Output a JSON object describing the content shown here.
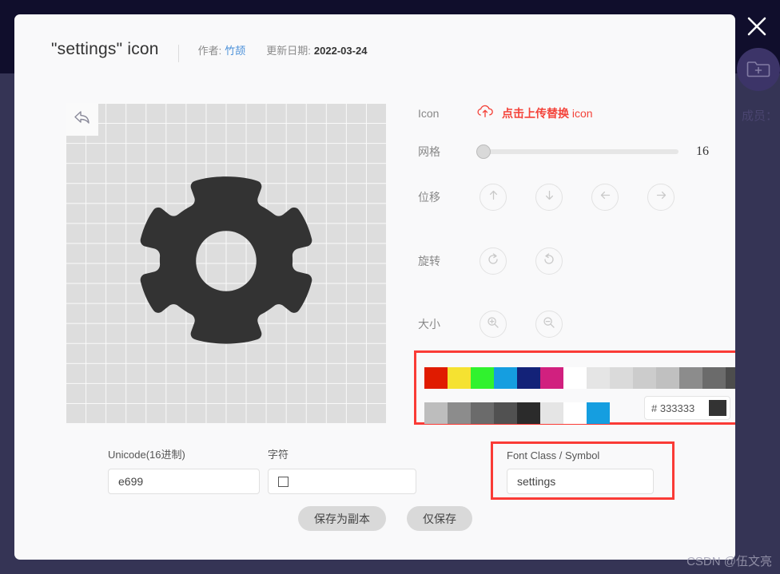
{
  "backdrop": {
    "close_icon": "close-icon",
    "folder_add_icon": "folder-plus-icon",
    "member_label": "成员：",
    "colors": {
      "top": "#100e2c",
      "body": "#353455",
      "circle": "#3c3468"
    }
  },
  "header": {
    "title_quoted": "\"settings\"",
    "title_suffix": "icon",
    "author_label": "作者:",
    "author_name": "竹颉",
    "date_label": "更新日期:",
    "date_value": "2022-03-24"
  },
  "canvas": {
    "undo_icon": "undo-arrow-icon",
    "glyph_icon": "gear-icon",
    "glyph_color": "#333333",
    "grid_cells": 16
  },
  "controls": {
    "icon_row": {
      "label": "Icon",
      "upload_icon": "cloud-upload-icon",
      "upload_text_cn": "点击上传替换 ",
      "upload_text_en": "icon",
      "accent": "#f4433a"
    },
    "grid_row": {
      "label": "网格",
      "value": "16",
      "min": 0,
      "max": 100,
      "thumb_percent": 0
    },
    "move_row": {
      "label": "位移",
      "buttons": [
        {
          "name": "move-up-button",
          "icon": "arrow-up-icon"
        },
        {
          "name": "move-down-button",
          "icon": "arrow-down-icon"
        },
        {
          "name": "move-left-button",
          "icon": "arrow-left-icon"
        },
        {
          "name": "move-right-button",
          "icon": "arrow-right-icon"
        }
      ]
    },
    "rotate_row": {
      "label": "旋转",
      "buttons": [
        {
          "name": "rotate-cw-button",
          "icon": "rotate-clockwise-icon"
        },
        {
          "name": "rotate-ccw-button",
          "icon": "rotate-counterclockwise-icon"
        }
      ]
    },
    "size_row": {
      "label": "大小",
      "buttons": [
        {
          "name": "zoom-in-button",
          "icon": "magnifier-plus-icon"
        },
        {
          "name": "zoom-out-button",
          "icon": "magnifier-minus-icon"
        }
      ]
    }
  },
  "color_panel": {
    "highlight_color": "#fa3b36",
    "row1": [
      "#e01b00",
      "#f5e231",
      "#30f22e",
      "#159ee0",
      "#132278",
      "#d1207f",
      "#ffffff",
      "#e5e5e5",
      "#dadada",
      "#cccccc",
      "#c0c0c0",
      "#8c8c8c",
      "#6b6b6b",
      "#4d4d4d",
      "#2b2b2b"
    ],
    "row2": [
      "#bdbdbd",
      "#8c8c8c",
      "#6b6b6b",
      "#515151",
      "#2b2b2b",
      "#e5e5e5",
      "#ffffff",
      "#159ee0"
    ],
    "hex_prefix": "#",
    "hex_value": "333333",
    "hex_preview": "#333333"
  },
  "fields": {
    "unicode": {
      "label": "Unicode(16进制)",
      "value": "e699"
    },
    "char": {
      "label": "字符",
      "value": "",
      "glyph_icon": "missing-glyph-box-icon"
    },
    "font_class": {
      "label": "Font Class / Symbol",
      "value": "settings"
    }
  },
  "actions": {
    "save_copy": "保存为副本",
    "save_only": "仅保存"
  },
  "watermark": "CSDN @伍文亮"
}
